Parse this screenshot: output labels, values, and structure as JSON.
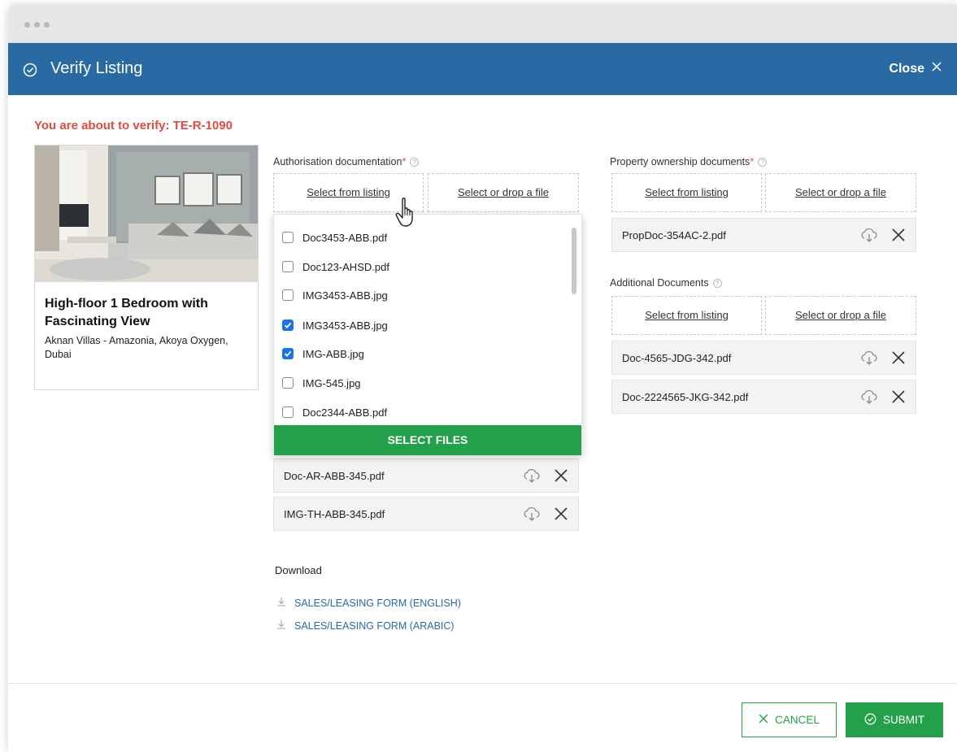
{
  "header": {
    "title": "Verify Listing",
    "close_label": "Close"
  },
  "warning": "You are about to verify: TE-R-1090",
  "listing": {
    "name": "High-floor 1 Bedroom with Fascinating View",
    "address": "Aknan Villas - Amazonia, Akoya Oxygen, Dubai"
  },
  "auth": {
    "label": "Authorisation documentation",
    "required": "*",
    "select_from_listing": "Select from listing",
    "select_or_drop": "Select or drop a file",
    "files": [
      {
        "name": "Doc-AR-ABB-345.pdf"
      },
      {
        "name": "IMG-TH-ABB-345.pdf"
      }
    ]
  },
  "dropdown": {
    "items": [
      {
        "name": "Doc3453-ABB.pdf",
        "checked": false
      },
      {
        "name": "Doc123-AHSD.pdf",
        "checked": false
      },
      {
        "name": "IMG3453-ABB.jpg",
        "checked": false
      },
      {
        "name": "IMG3453-ABB.jpg",
        "checked": true
      },
      {
        "name": "IMG-ABB.jpg",
        "checked": true
      },
      {
        "name": "IMG-545.jpg",
        "checked": false
      },
      {
        "name": "Doc2344-ABB.pdf",
        "checked": false
      }
    ],
    "button_label": "SELECT FILES"
  },
  "ownership": {
    "label": "Property ownership documents",
    "required": "*",
    "select_from_listing": "Select from listing",
    "select_or_drop": "Select or drop a file",
    "files": [
      {
        "name": "PropDoc-354AC-2.pdf"
      }
    ]
  },
  "additional": {
    "label": "Additional Documents",
    "select_from_listing": "Select from listing",
    "select_or_drop": "Select or drop a file",
    "files": [
      {
        "name": "Doc-4565-JDG-342.pdf"
      },
      {
        "name": "Doc-2224565-JKG-342.pdf"
      }
    ]
  },
  "download": {
    "title": "Download",
    "links": [
      {
        "label": "SALES/LEASING FORM (ENGLISH)"
      },
      {
        "label": "SALES/LEASING FORM (ARABIC)"
      }
    ]
  },
  "footer": {
    "cancel_label": "CANCEL",
    "submit_label": "SUBMIT"
  },
  "colors": {
    "header": "#2a6aa3",
    "accent": "#23a14a",
    "warning": "#e04a3f",
    "checkbox": "#1a73e8"
  },
  "icons": [
    "check-circle-icon",
    "close-icon",
    "help-icon",
    "cloud-download-icon",
    "download-icon",
    "hand-cursor-icon"
  ]
}
